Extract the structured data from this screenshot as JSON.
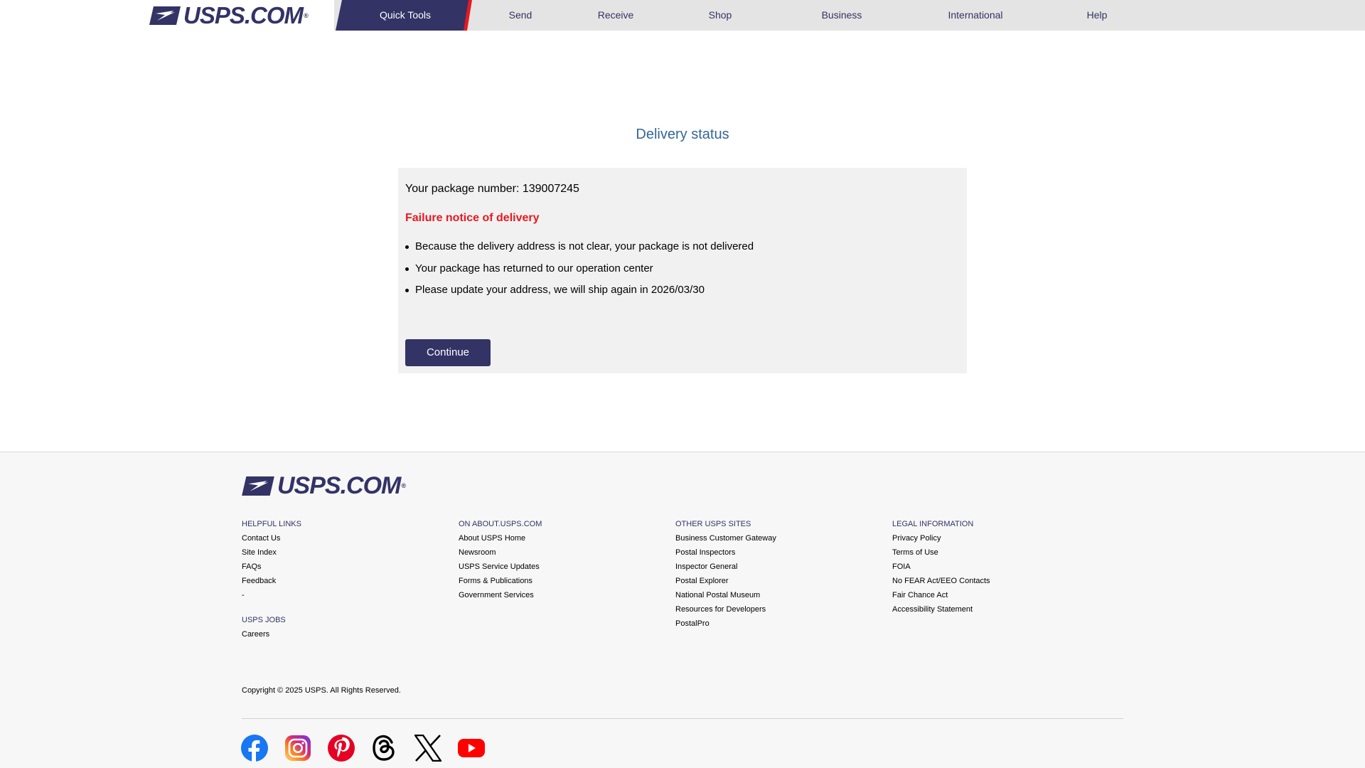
{
  "header": {
    "logo_text": "USPS.COM",
    "logo_reg": "®",
    "nav": [
      {
        "label": "Quick Tools"
      },
      {
        "label": "Send"
      },
      {
        "label": "Receive"
      },
      {
        "label": "Shop"
      },
      {
        "label": "Business"
      },
      {
        "label": "International"
      },
      {
        "label": "Help"
      }
    ],
    "colors": {
      "brand": "#333366",
      "accent_red": "#e71921",
      "nav_bg": "#e4e4e4"
    }
  },
  "main": {
    "title": "Delivery status",
    "package_line": "Your package number: 139007245",
    "failure_heading": "Failure notice of delivery",
    "bullets": [
      "Because the delivery address is not clear, your package is not delivered",
      "Your package has returned to our operation center",
      "Please update your address, we will ship again in 2026/03/30"
    ],
    "continue_label": "Continue"
  },
  "footer": {
    "logo_text": "USPS.COM",
    "logo_reg": "®",
    "helpful": {
      "heading": "HELPFUL LINKS",
      "links": [
        "Contact Us",
        "Site Index",
        "FAQs",
        "Feedback",
        "-"
      ]
    },
    "jobs": {
      "heading": "USPS JOBS",
      "links": [
        "Careers"
      ]
    },
    "about": {
      "heading": "ON ABOUT.USPS.COM",
      "links": [
        "About USPS Home",
        "Newsroom",
        "USPS Service Updates",
        "Forms & Publications",
        "Government Services"
      ]
    },
    "other": {
      "heading": "OTHER USPS SITES",
      "links": [
        "Business Customer Gateway",
        "Postal Inspectors",
        "Inspector General",
        "Postal Explorer",
        "National Postal Museum",
        "Resources for Developers",
        "PostalPro"
      ]
    },
    "legal": {
      "heading": "LEGAL INFORMATION",
      "links": [
        "Privacy Policy",
        "Terms of Use",
        "FOIA",
        "No FEAR Act/EEO Contacts",
        "Fair Chance Act",
        "Accessibility Statement"
      ]
    },
    "copyright": "Copyright © 2025 USPS. All Rights Reserved.",
    "social": [
      {
        "icon": "facebook-icon"
      },
      {
        "icon": "instagram-icon"
      },
      {
        "icon": "pinterest-icon"
      },
      {
        "icon": "threads-icon"
      },
      {
        "icon": "x-icon"
      },
      {
        "icon": "youtube-icon"
      }
    ]
  }
}
